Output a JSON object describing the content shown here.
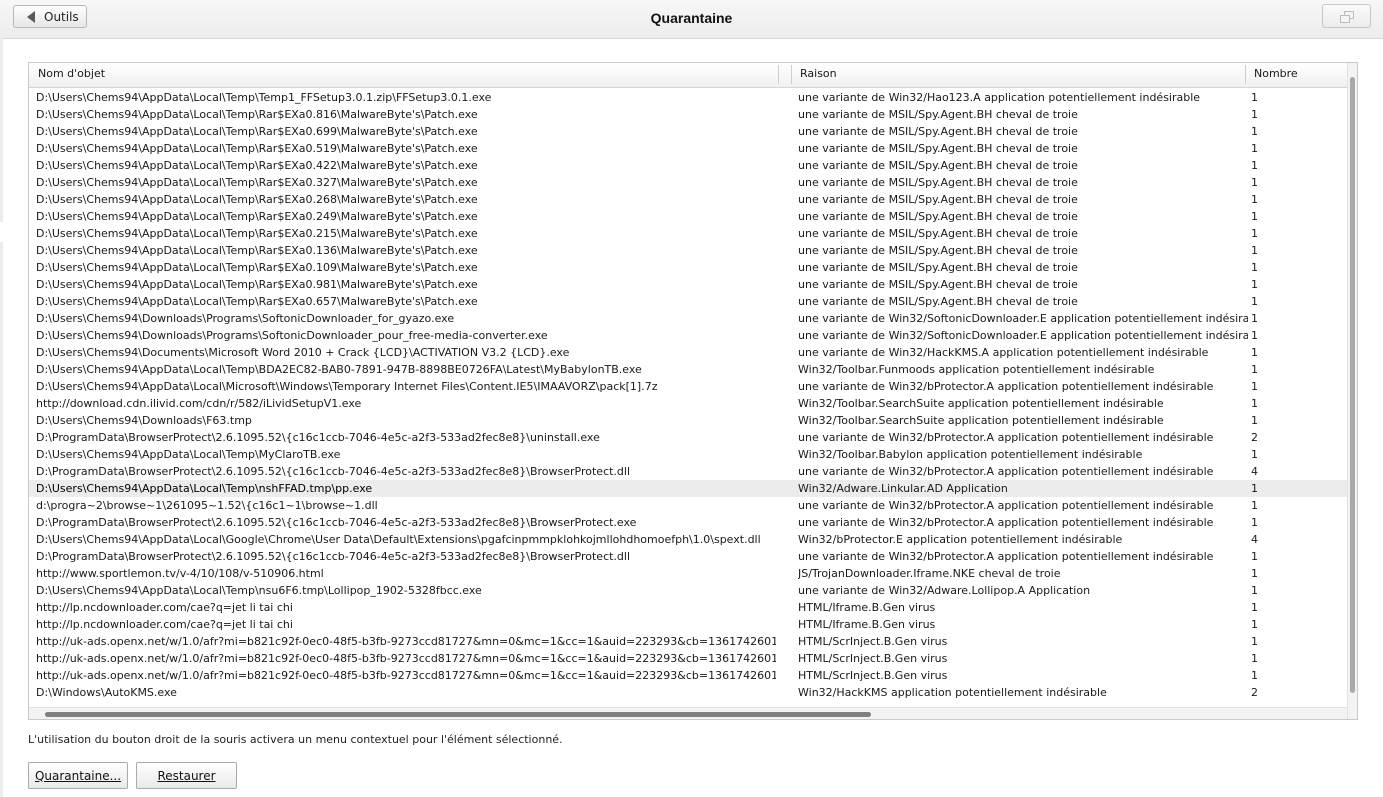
{
  "header": {
    "back_label": "Outils",
    "title": "Quarantaine"
  },
  "table": {
    "columns": [
      "Nom d'objet",
      "Raison",
      "Nombre"
    ],
    "rows": [
      {
        "name": "D:\\Users\\Chems94\\AppData\\Local\\Temp\\Temp1_FFSetup3.0.1.zip\\FFSetup3.0.1.exe",
        "reason": "une variante de Win32/Hao123.A application potentiellement indésirable",
        "count": "1"
      },
      {
        "name": "D:\\Users\\Chems94\\AppData\\Local\\Temp\\Rar$EXa0.816\\MalwareByte's\\Patch.exe",
        "reason": "une variante de MSIL/Spy.Agent.BH cheval de troie",
        "count": "1"
      },
      {
        "name": "D:\\Users\\Chems94\\AppData\\Local\\Temp\\Rar$EXa0.699\\MalwareByte's\\Patch.exe",
        "reason": "une variante de MSIL/Spy.Agent.BH cheval de troie",
        "count": "1"
      },
      {
        "name": "D:\\Users\\Chems94\\AppData\\Local\\Temp\\Rar$EXa0.519\\MalwareByte's\\Patch.exe",
        "reason": "une variante de MSIL/Spy.Agent.BH cheval de troie",
        "count": "1"
      },
      {
        "name": "D:\\Users\\Chems94\\AppData\\Local\\Temp\\Rar$EXa0.422\\MalwareByte's\\Patch.exe",
        "reason": "une variante de MSIL/Spy.Agent.BH cheval de troie",
        "count": "1"
      },
      {
        "name": "D:\\Users\\Chems94\\AppData\\Local\\Temp\\Rar$EXa0.327\\MalwareByte's\\Patch.exe",
        "reason": "une variante de MSIL/Spy.Agent.BH cheval de troie",
        "count": "1"
      },
      {
        "name": "D:\\Users\\Chems94\\AppData\\Local\\Temp\\Rar$EXa0.268\\MalwareByte's\\Patch.exe",
        "reason": "une variante de MSIL/Spy.Agent.BH cheval de troie",
        "count": "1"
      },
      {
        "name": "D:\\Users\\Chems94\\AppData\\Local\\Temp\\Rar$EXa0.249\\MalwareByte's\\Patch.exe",
        "reason": "une variante de MSIL/Spy.Agent.BH cheval de troie",
        "count": "1"
      },
      {
        "name": "D:\\Users\\Chems94\\AppData\\Local\\Temp\\Rar$EXa0.215\\MalwareByte's\\Patch.exe",
        "reason": "une variante de MSIL/Spy.Agent.BH cheval de troie",
        "count": "1"
      },
      {
        "name": "D:\\Users\\Chems94\\AppData\\Local\\Temp\\Rar$EXa0.136\\MalwareByte's\\Patch.exe",
        "reason": "une variante de MSIL/Spy.Agent.BH cheval de troie",
        "count": "1"
      },
      {
        "name": "D:\\Users\\Chems94\\AppData\\Local\\Temp\\Rar$EXa0.109\\MalwareByte's\\Patch.exe",
        "reason": "une variante de MSIL/Spy.Agent.BH cheval de troie",
        "count": "1"
      },
      {
        "name": "D:\\Users\\Chems94\\AppData\\Local\\Temp\\Rar$EXa0.981\\MalwareByte's\\Patch.exe",
        "reason": "une variante de MSIL/Spy.Agent.BH cheval de troie",
        "count": "1"
      },
      {
        "name": "D:\\Users\\Chems94\\AppData\\Local\\Temp\\Rar$EXa0.657\\MalwareByte's\\Patch.exe",
        "reason": "une variante de MSIL/Spy.Agent.BH cheval de troie",
        "count": "1"
      },
      {
        "name": "D:\\Users\\Chems94\\Downloads\\Programs\\SoftonicDownloader_for_gyazo.exe",
        "reason": "une variante de Win32/SoftonicDownloader.E application potentiellement indésirable",
        "count": "1"
      },
      {
        "name": "D:\\Users\\Chems94\\Downloads\\Programs\\SoftonicDownloader_pour_free-media-converter.exe",
        "reason": "une variante de Win32/SoftonicDownloader.E application potentiellement indésirable",
        "count": "1"
      },
      {
        "name": "D:\\Users\\Chems94\\Documents\\Microsoft Word 2010 + Crack {LCD}\\ACTIVATION V3.2 {LCD}.exe",
        "reason": "une variante de Win32/HackKMS.A application potentiellement indésirable",
        "count": "1"
      },
      {
        "name": "D:\\Users\\Chems94\\AppData\\Local\\Temp\\BDA2EC82-BAB0-7891-947B-8898BE0726FA\\Latest\\MyBabylonTB.exe",
        "reason": "Win32/Toolbar.Funmoods application potentiellement indésirable",
        "count": "1"
      },
      {
        "name": "D:\\Users\\Chems94\\AppData\\Local\\Microsoft\\Windows\\Temporary Internet Files\\Content.IE5\\IMAAVORZ\\pack[1].7z",
        "reason": "une variante de Win32/bProtector.A application potentiellement indésirable",
        "count": "1"
      },
      {
        "name": "http://download.cdn.ilivid.com/cdn/r/582/iLividSetupV1.exe",
        "reason": "Win32/Toolbar.SearchSuite application potentiellement indésirable",
        "count": "1"
      },
      {
        "name": "D:\\Users\\Chems94\\Downloads\\F63.tmp",
        "reason": "Win32/Toolbar.SearchSuite application potentiellement indésirable",
        "count": "1"
      },
      {
        "name": "D:\\ProgramData\\BrowserProtect\\2.6.1095.52\\{c16c1ccb-7046-4e5c-a2f3-533ad2fec8e8}\\uninstall.exe",
        "reason": "une variante de Win32/bProtector.A application potentiellement indésirable",
        "count": "2"
      },
      {
        "name": "D:\\Users\\Chems94\\AppData\\Local\\Temp\\MyClaroTB.exe",
        "reason": "Win32/Toolbar.Babylon application potentiellement indésirable",
        "count": "1"
      },
      {
        "name": "D:\\ProgramData\\BrowserProtect\\2.6.1095.52\\{c16c1ccb-7046-4e5c-a2f3-533ad2fec8e8}\\BrowserProtect.dll",
        "reason": "une variante de Win32/bProtector.A application potentiellement indésirable",
        "count": "4"
      },
      {
        "name": "D:\\Users\\Chems94\\AppData\\Local\\Temp\\nshFFAD.tmp\\pp.exe",
        "reason": "Win32/Adware.Linkular.AD Application",
        "count": "1",
        "selected": true
      },
      {
        "name": "d:\\progra~2\\browse~1\\261095~1.52\\{c16c1~1\\browse~1.dll",
        "reason": "une variante de Win32/bProtector.A application potentiellement indésirable",
        "count": "1"
      },
      {
        "name": "D:\\ProgramData\\BrowserProtect\\2.6.1095.52\\{c16c1ccb-7046-4e5c-a2f3-533ad2fec8e8}\\BrowserProtect.exe",
        "reason": "une variante de Win32/bProtector.A application potentiellement indésirable",
        "count": "1"
      },
      {
        "name": "D:\\Users\\Chems94\\AppData\\Local\\Google\\Chrome\\User Data\\Default\\Extensions\\pgafcinpmmpklohkojmllohdhomoefph\\1.0\\spext.dll",
        "reason": "Win32/bProtector.E application potentiellement indésirable",
        "count": "4"
      },
      {
        "name": "D:\\ProgramData\\BrowserProtect\\2.6.1095.52\\{c16c1ccb-7046-4e5c-a2f3-533ad2fec8e8}\\BrowserProtect.dll",
        "reason": "une variante de Win32/bProtector.A application potentiellement indésirable",
        "count": "1"
      },
      {
        "name": "http://www.sportlemon.tv/v-4/10/108/v-510906.html",
        "reason": "JS/TrojanDownloader.Iframe.NKE cheval de troie",
        "count": "1"
      },
      {
        "name": "D:\\Users\\Chems94\\AppData\\Local\\Temp\\nsu6F6.tmp\\Lollipop_1902-5328fbcc.exe",
        "reason": "une variante de Win32/Adware.Lollipop.A Application",
        "count": "1"
      },
      {
        "name": "http://lp.ncdownloader.com/cae?q=jet li tai chi",
        "reason": "HTML/Iframe.B.Gen virus",
        "count": "1"
      },
      {
        "name": "http://lp.ncdownloader.com/cae?q=jet li tai chi",
        "reason": "HTML/Iframe.B.Gen virus",
        "count": "1"
      },
      {
        "name": "http://uk-ads.openx.net/w/1.0/afr?mi=b821c92f-0ec0-48f5-b3fb-9273ccd81727&mn=0&mc=1&cc=1&auid=223293&cb=1361742601",
        "reason": "HTML/ScrInject.B.Gen virus",
        "count": "1"
      },
      {
        "name": "http://uk-ads.openx.net/w/1.0/afr?mi=b821c92f-0ec0-48f5-b3fb-9273ccd81727&mn=0&mc=1&cc=1&auid=223293&cb=1361742601",
        "reason": "HTML/ScrInject.B.Gen virus",
        "count": "1"
      },
      {
        "name": "http://uk-ads.openx.net/w/1.0/afr?mi=b821c92f-0ec0-48f5-b3fb-9273ccd81727&mn=0&mc=1&cc=1&auid=223293&cb=1361742601",
        "reason": "HTML/ScrInject.B.Gen virus",
        "count": "1"
      },
      {
        "name": "D:\\Windows\\AutoKMS.exe",
        "reason": "Win32/HackKMS application potentiellement indésirable",
        "count": "2"
      }
    ]
  },
  "hint": "L'utilisation du bouton droit de la souris activera un menu contextuel pour l'élément sélectionné.",
  "buttons": {
    "quarantine": "Quarantaine...",
    "restore": "Restaurer"
  }
}
